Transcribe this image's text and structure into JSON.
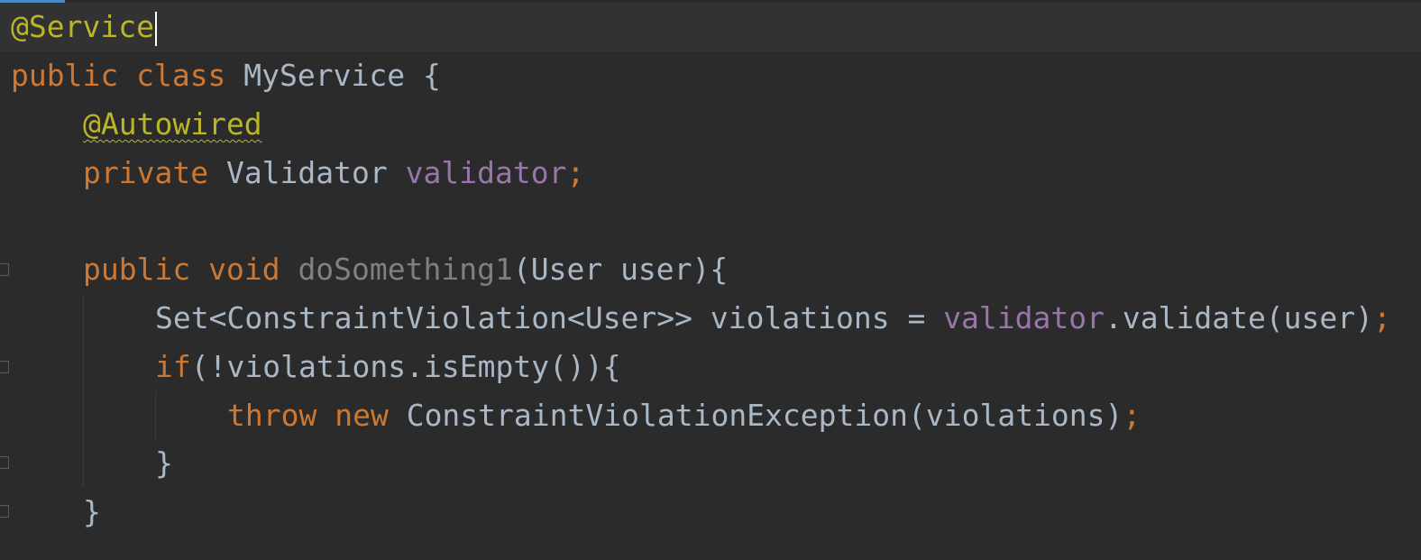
{
  "editor": {
    "lines": [
      {
        "tokens": [
          "@Service"
        ]
      },
      {
        "tokens": [
          "public",
          " class ",
          "MyService",
          " {"
        ]
      },
      {
        "tokens": [
          "@Autowired"
        ]
      },
      {
        "tokens": [
          "private",
          " Validator ",
          "validator",
          ";"
        ]
      },
      {
        "tokens": [
          ""
        ]
      },
      {
        "tokens": [
          "public",
          " void ",
          "doSomething1",
          "(User user){"
        ]
      },
      {
        "tokens": [
          "Set<ConstraintViolation<User>> violations = ",
          "validator",
          ".validate(user)",
          ";"
        ]
      },
      {
        "tokens": [
          "if",
          "(!violations.isEmpty()){"
        ]
      },
      {
        "tokens": [
          "throw",
          " ",
          "new",
          " ConstraintViolationException(violations)",
          ";"
        ]
      },
      {
        "tokens": [
          "}"
        ]
      },
      {
        "tokens": [
          "}"
        ]
      }
    ]
  },
  "colors": {
    "background": "#2b2b2b",
    "current_line": "#323232",
    "keyword": "#cc7832",
    "annotation": "#bbb529",
    "field": "#9876aa",
    "unused_method": "#808080",
    "plain": "#a9b7c6",
    "accent": "#4a88c7"
  }
}
